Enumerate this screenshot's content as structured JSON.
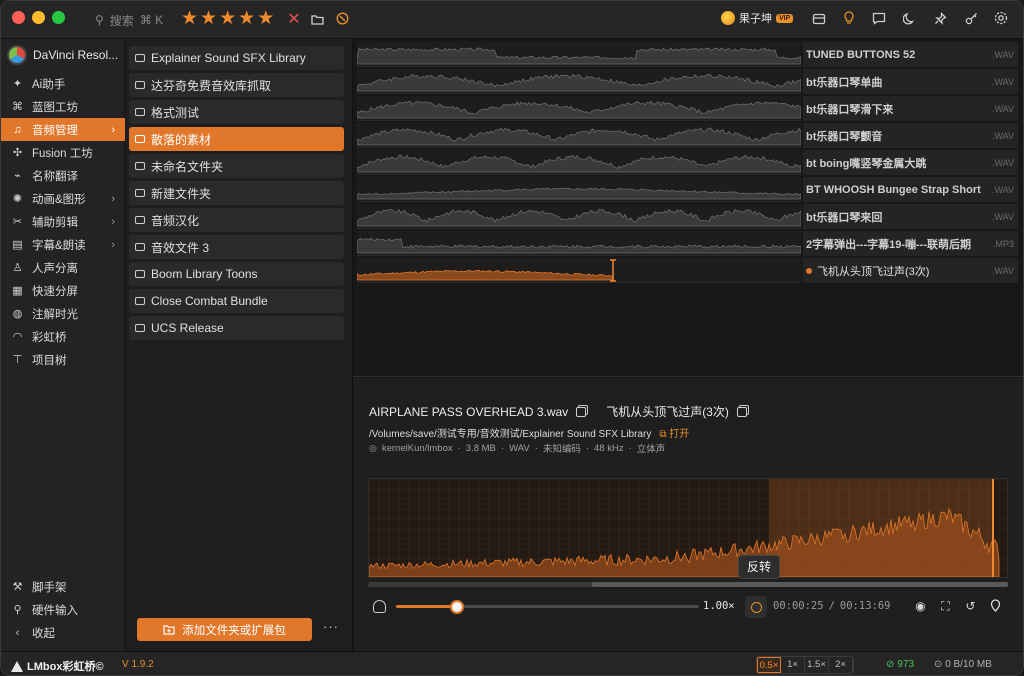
{
  "titlebar": {
    "search_label": "搜索",
    "search_shortcut": "⌘ K",
    "rating_stars": 5,
    "user_name": "果子坤",
    "user_badge": "VIP"
  },
  "sidebar": {
    "app_name": "DaVinci Resol...",
    "items": [
      {
        "label": "Ai助手",
        "icon": "ai-icon"
      },
      {
        "label": "蓝图工坊",
        "icon": "blueprint-icon"
      },
      {
        "label": "音频管理",
        "icon": "audio-icon",
        "active": true,
        "chevron": true
      },
      {
        "label": "Fusion 工坊",
        "icon": "fusion-icon"
      },
      {
        "label": "名称翻译",
        "icon": "translate-icon"
      },
      {
        "label": "动画&图形",
        "icon": "animation-icon",
        "chevron": true
      },
      {
        "label": "辅助剪辑",
        "icon": "edit-assist-icon",
        "chevron": true
      },
      {
        "label": "字幕&朗读",
        "icon": "subtitle-icon",
        "chevron": true
      },
      {
        "label": "人声分离",
        "icon": "voice-split-icon"
      },
      {
        "label": "快速分屏",
        "icon": "split-screen-icon"
      },
      {
        "label": "注解时光",
        "icon": "annotation-icon"
      },
      {
        "label": "彩虹桥",
        "icon": "rainbow-icon"
      },
      {
        "label": "项目树",
        "icon": "tree-icon"
      }
    ],
    "bottom_items": [
      {
        "label": "脚手架",
        "icon": "scaffold-icon"
      },
      {
        "label": "硬件输入",
        "icon": "hardware-icon"
      },
      {
        "label": "收起",
        "icon": "collapse-icon"
      }
    ]
  },
  "folders": {
    "items": [
      {
        "label": "Explainer Sound SFX Library"
      },
      {
        "label": "达芬奇免费音效库抓取"
      },
      {
        "label": "格式测试"
      },
      {
        "label": "散落的素材",
        "active": true
      },
      {
        "label": "未命名文件夹"
      },
      {
        "label": "新建文件夹"
      },
      {
        "label": "音频汉化"
      },
      {
        "label": "音效文件 3"
      },
      {
        "label": "Boom Library Toons"
      },
      {
        "label": "Close Combat Bundle"
      },
      {
        "label": "UCS Release"
      }
    ],
    "add_button": "添加文件夹或扩展包",
    "more_button": "···"
  },
  "tracks": [
    {
      "name": "TUNED BUTTONS 52",
      "ext": ".WAV"
    },
    {
      "name": "bt乐器口琴单曲",
      "ext": ".WAV"
    },
    {
      "name": "bt乐器口琴滑下来",
      "ext": ".WAV"
    },
    {
      "name": "bt乐器口琴颤音",
      "ext": ".WAV"
    },
    {
      "name": "bt boing嘴竖琴金属大跳",
      "ext": ".WAV"
    },
    {
      "name": "BT WHOOSH Bungee Strap Short",
      "ext": ".WAV"
    },
    {
      "name": "bt乐器口琴来回",
      "ext": ".WAV"
    },
    {
      "name": "2字幕弹出---字幕19-嘣---联萌后期",
      "ext": ".MP3"
    },
    {
      "name": "飞机从头顶飞过声(3次)",
      "ext": ".WAV",
      "playing": true
    }
  ],
  "details": {
    "filename": "AIRPLANE PASS OVERHEAD 3.wav",
    "translated_name": "飞机从头顶飞过声(3次)",
    "path": "/Volumes/save/测试专用/音效测试/Explainer Sound SFX Library",
    "open_label": "打开",
    "author": "kernelKun/lmbox",
    "size": "3.8 MB",
    "format": "WAV",
    "encoding": "未知编码",
    "sample_rate": "48 kHz",
    "channels": "立体声",
    "separator": "·"
  },
  "player": {
    "rate": "1.00×",
    "rate_value": 0.2,
    "tooltip": "反转",
    "current_time": "00:00:25",
    "time_sep": "/",
    "total_time": "00:13:69",
    "scroll_fraction": 0.35
  },
  "statusbar": {
    "brand": "LMbox彩虹桥©",
    "version": "V 1.9.2",
    "speeds": [
      "0.5×",
      "1×",
      "1.5×",
      "2×"
    ],
    "active_speed": 0,
    "count": "973",
    "memory": "0 B/10 MB"
  },
  "colors": {
    "accent": "#e0772a",
    "accent_text": "#e8902a",
    "green": "#4fbf5f"
  }
}
